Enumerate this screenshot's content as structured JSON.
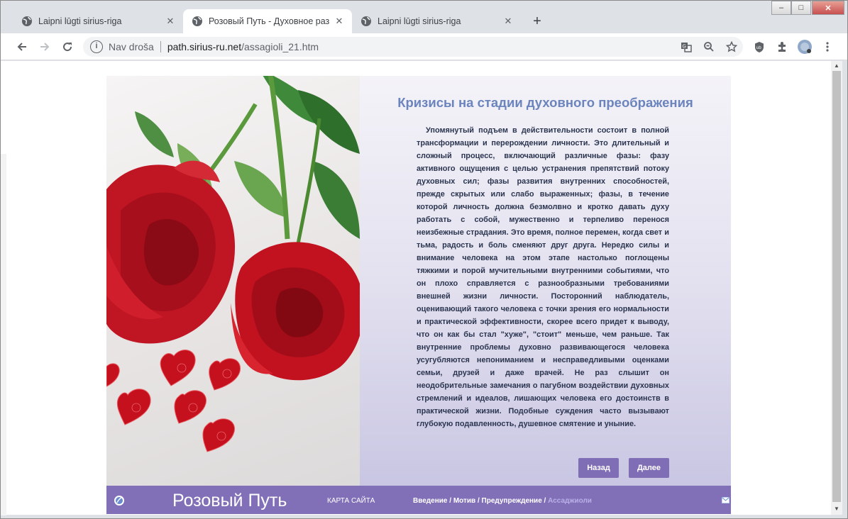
{
  "browser": {
    "tabs": [
      {
        "title": "Laipni lūgti sirius-riga",
        "active": false
      },
      {
        "title": "Розовый Путь - Духовное развитие",
        "active": true
      },
      {
        "title": "Laipni lūgti sirius-riga",
        "active": false
      }
    ],
    "new_tab": "+",
    "window_controls": {
      "minimize": "–",
      "maximize": "□",
      "close": "✕"
    },
    "address": {
      "security_label": "Nav droša",
      "host": "path.sirius-ru.net",
      "path": "/assagioli_21.htm"
    },
    "toolbar_icons": [
      "back-icon",
      "forward-icon",
      "reload-icon",
      "translate-icon",
      "zoom-icon",
      "bookmark-star-icon",
      "ublock-icon",
      "extensions-icon",
      "profile-avatar",
      "menu-icon"
    ]
  },
  "page": {
    "heading": "Кризисы на стадии духовного преображения",
    "article": "Упомянутый подъем в действительности состоит в полной трансформации и перерождении личности. Это длительный и сложный процесс, включающий различные фазы: фазу активного ощущения с целью устранения препятствий потоку духовных сил; фазы развития внутренних способностей, прежде скрытых или слабо выраженных; фазы, в течение которой личность должна безмолвно и кротко давать духу работать с собой, мужественно и терпеливо перенося неизбежные страдания. Это время, полное перемен, когда свет и тьма, радость и боль сменяют друг друга. Нередко силы и внимание человека на этом этапе настолько поглощены тяжкими и порой мучительными внутренними событиями, что он плохо справляется с разнообразными требованиями внешней жизни личности. Посторонний наблюдатель, оценивающий такого человека с точки зрения его нормальности и практической эффективности, скорее всего придет к выводу, что он как бы стал \"хуже\", \"стоит\" меньше, чем раньше. Так внутренние проблемы духовно развивающегося человека усугубляются непониманием и несправедливыми оценками семьи, друзей и даже врачей. Не раз слышит он неодобрительные замечания о пагубном воздействии духовных стремлений и идеалов, лишающих человека его достоинств в практической жизни. Подобные суждения часто вызывают глубокую подавленность, душевное смятение и уныние.",
    "back_button": "Назад",
    "next_button": "Далее"
  },
  "footer": {
    "site_name": "Розовый Путь",
    "sitemap_link": "КАРТА САЙТА",
    "breadcrumb": {
      "intro": "Введение",
      "motive": "Мотив",
      "warning": "Предупреждение",
      "current": "Ассаджиоли",
      "separator": " / "
    }
  },
  "colors": {
    "accent": "#8170b8",
    "heading": "#6b84bd",
    "text": "#2b3550",
    "button": "#7f6db5"
  }
}
